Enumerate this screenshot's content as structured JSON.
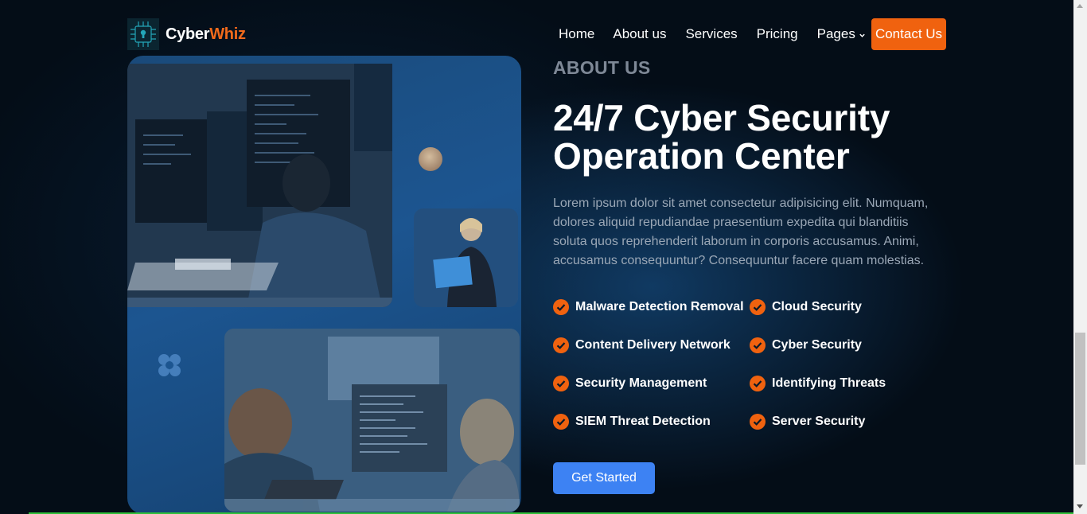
{
  "brand": {
    "name_part1": "Cyber",
    "name_part2": "Whiz"
  },
  "nav": {
    "items": [
      "Home",
      "About us",
      "Services",
      "Pricing",
      "Pages"
    ],
    "contact_label": "Contact Us"
  },
  "about": {
    "eyebrow": "ABOUT US",
    "title_line1": "24/7 Cyber Security",
    "title_line2": "Operation Center",
    "description": "Lorem ipsum dolor sit amet consectetur adipisicing elit. Numquam, dolores aliquid repudiandae praesentium expedita qui blanditiis soluta quos reprehenderit laborum in corporis accusamus. Animi, accusamus consequuntur? Consequuntur facere quam molestias.",
    "features": [
      "Malware Detection Removal",
      "Cloud Security",
      "Content Delivery Network",
      "Cyber Security",
      "Security Management",
      "Identifying Threats",
      "SIEM Threat Detection",
      "Server Security"
    ],
    "cta_label": "Get Started"
  },
  "colors": {
    "accent_orange": "#f0620f",
    "button_blue": "#3d82f3",
    "background": "#040d17"
  },
  "icons": {
    "logo": "keyhole-chip-icon",
    "dropdown": "chevron-down-icon",
    "feature": "check-circle-icon"
  }
}
